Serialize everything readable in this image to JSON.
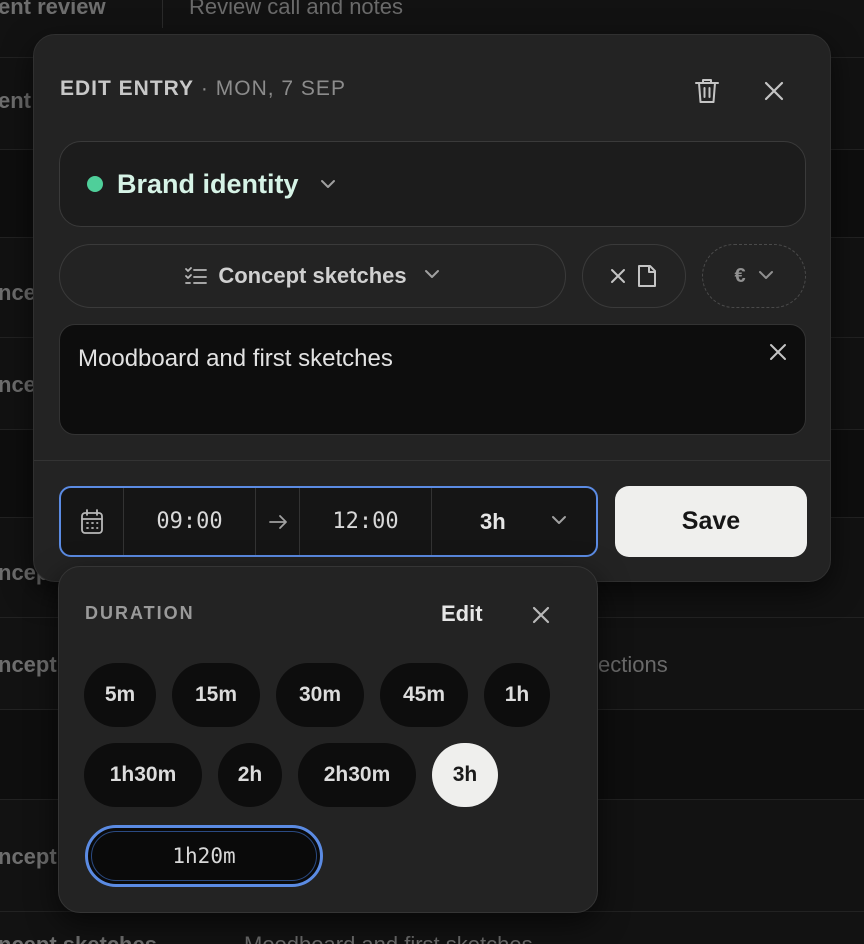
{
  "background": {
    "rows": [
      {
        "col1": "ent review",
        "col2": "Review call and notes"
      },
      {
        "col1": "ent",
        "col2": ""
      },
      {
        "col1": "nce",
        "col2": ""
      },
      {
        "col1": "nce",
        "col2": ""
      },
      {
        "col1": "ncep",
        "col2": ""
      },
      {
        "col1": "ncept",
        "col2": "ections"
      },
      {
        "col1": "ncept",
        "col2": ""
      },
      {
        "col1": "ncept sketches",
        "col2": "Moodboard and first sketches"
      }
    ]
  },
  "modal": {
    "title": "EDIT ENTRY",
    "separator": "·",
    "date": "MON, 7 SEP",
    "trash_icon": "trash-icon",
    "close_icon": "close-icon"
  },
  "project": {
    "label": "Brand identity",
    "dot_color": "#4fcf9a"
  },
  "task": {
    "label": "Concept sketches",
    "icon": "checklist-icon"
  },
  "file_button": {
    "icons": [
      "close-icon",
      "file-icon"
    ]
  },
  "currency": {
    "symbol": "€"
  },
  "notes": {
    "value": "Moodboard and first sketches"
  },
  "time": {
    "start": "09:00",
    "end": "12:00",
    "duration": "3h"
  },
  "save_label": "Save",
  "duration_popover": {
    "title": "DURATION",
    "edit_label": "Edit",
    "chips": [
      "5m",
      "15m",
      "30m",
      "45m",
      "1h",
      "1h30m",
      "2h",
      "2h30m",
      "3h"
    ],
    "selected": "3h",
    "custom_value": "1h20m"
  },
  "colors": {
    "accent_blue": "#5b8be3",
    "project_green": "#4fcf9a",
    "save_bg": "#efefed"
  }
}
